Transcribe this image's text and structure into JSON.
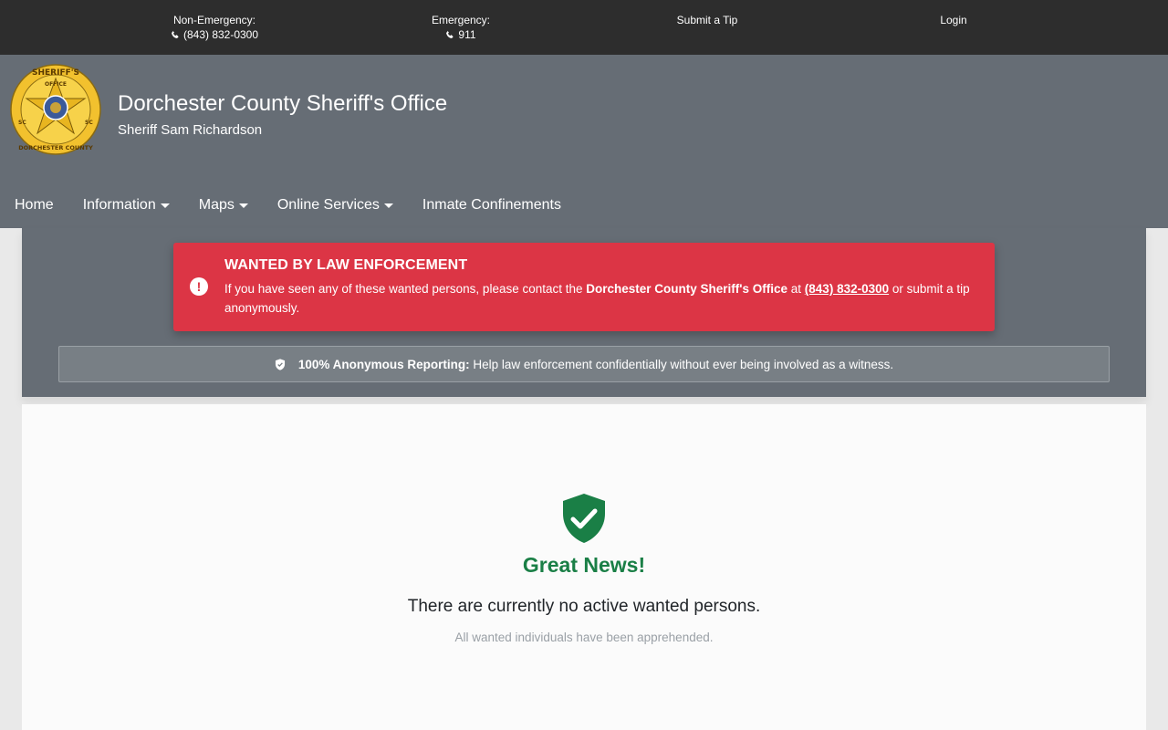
{
  "topbar": {
    "non_emergency_label": "Non-Emergency:",
    "non_emergency_phone": "(843) 832-0300",
    "emergency_label": "Emergency:",
    "emergency_phone": "911",
    "submit_tip": "Submit a Tip",
    "login": "Login"
  },
  "header": {
    "title": "Dorchester County Sheriff's Office",
    "subtitle": "Sheriff Sam Richardson",
    "badge_text_top": "SHERIFF'S",
    "badge_text_office": "OFFICE",
    "badge_text_bottom": "DORCHESTER COUNTY",
    "badge_text_sc": "SC"
  },
  "nav": {
    "items": [
      {
        "label": "Home",
        "dropdown": false
      },
      {
        "label": "Information",
        "dropdown": true
      },
      {
        "label": "Maps",
        "dropdown": true
      },
      {
        "label": "Online Services",
        "dropdown": true
      },
      {
        "label": "Inmate Confinements",
        "dropdown": false
      }
    ]
  },
  "alert": {
    "title": "WANTED BY LAW ENFORCEMENT",
    "text_before": "If you have seen any of these wanted persons, please contact the ",
    "agency": "Dorchester County Sheriff's Office",
    "text_at": " at ",
    "phone": "(843) 832-0300",
    "text_after": " or submit a tip anonymously."
  },
  "anonymous": {
    "bold": "100% Anonymous Reporting:",
    "text": "Help law enforcement confidentially without ever being involved as a witness."
  },
  "content": {
    "heading": "Great News!",
    "message": "There are currently no active wanted persons.",
    "submessage": "All wanted individuals have been apprehended."
  },
  "colors": {
    "topbar": "#2d2d2d",
    "header": "#666d75",
    "alert": "#dc3545",
    "success": "#1a7f46"
  }
}
